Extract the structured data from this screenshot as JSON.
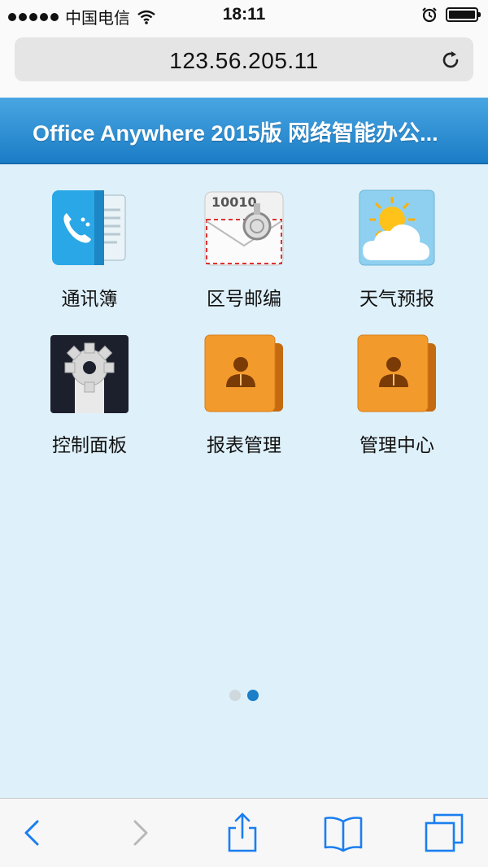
{
  "status_bar": {
    "carrier": "中国电信",
    "time": "18:11"
  },
  "address_bar": {
    "url": "123.56.205.11"
  },
  "header": {
    "title": "Office Anywhere 2015版 网络智能办公..."
  },
  "apps": [
    {
      "label": "通讯簿",
      "icon": "address-book-icon"
    },
    {
      "label": "区号邮编",
      "icon": "postcode-envelope-icon"
    },
    {
      "label": "天气预报",
      "icon": "weather-icon"
    },
    {
      "label": "控制面板",
      "icon": "control-panel-gear-icon"
    },
    {
      "label": "报表管理",
      "icon": "report-folder-icon"
    },
    {
      "label": "管理中心",
      "icon": "management-folder-icon"
    }
  ],
  "envelope_icon_text": "10010",
  "pager": {
    "pages": 2,
    "active": 2
  },
  "toolbar": {
    "items": [
      "back-icon",
      "forward-icon",
      "share-icon",
      "bookmarks-icon",
      "tabs-icon"
    ]
  },
  "colors": {
    "header": "#1b7dc6",
    "content_bg": "#def0f9",
    "accent": "#1a7ec8"
  }
}
